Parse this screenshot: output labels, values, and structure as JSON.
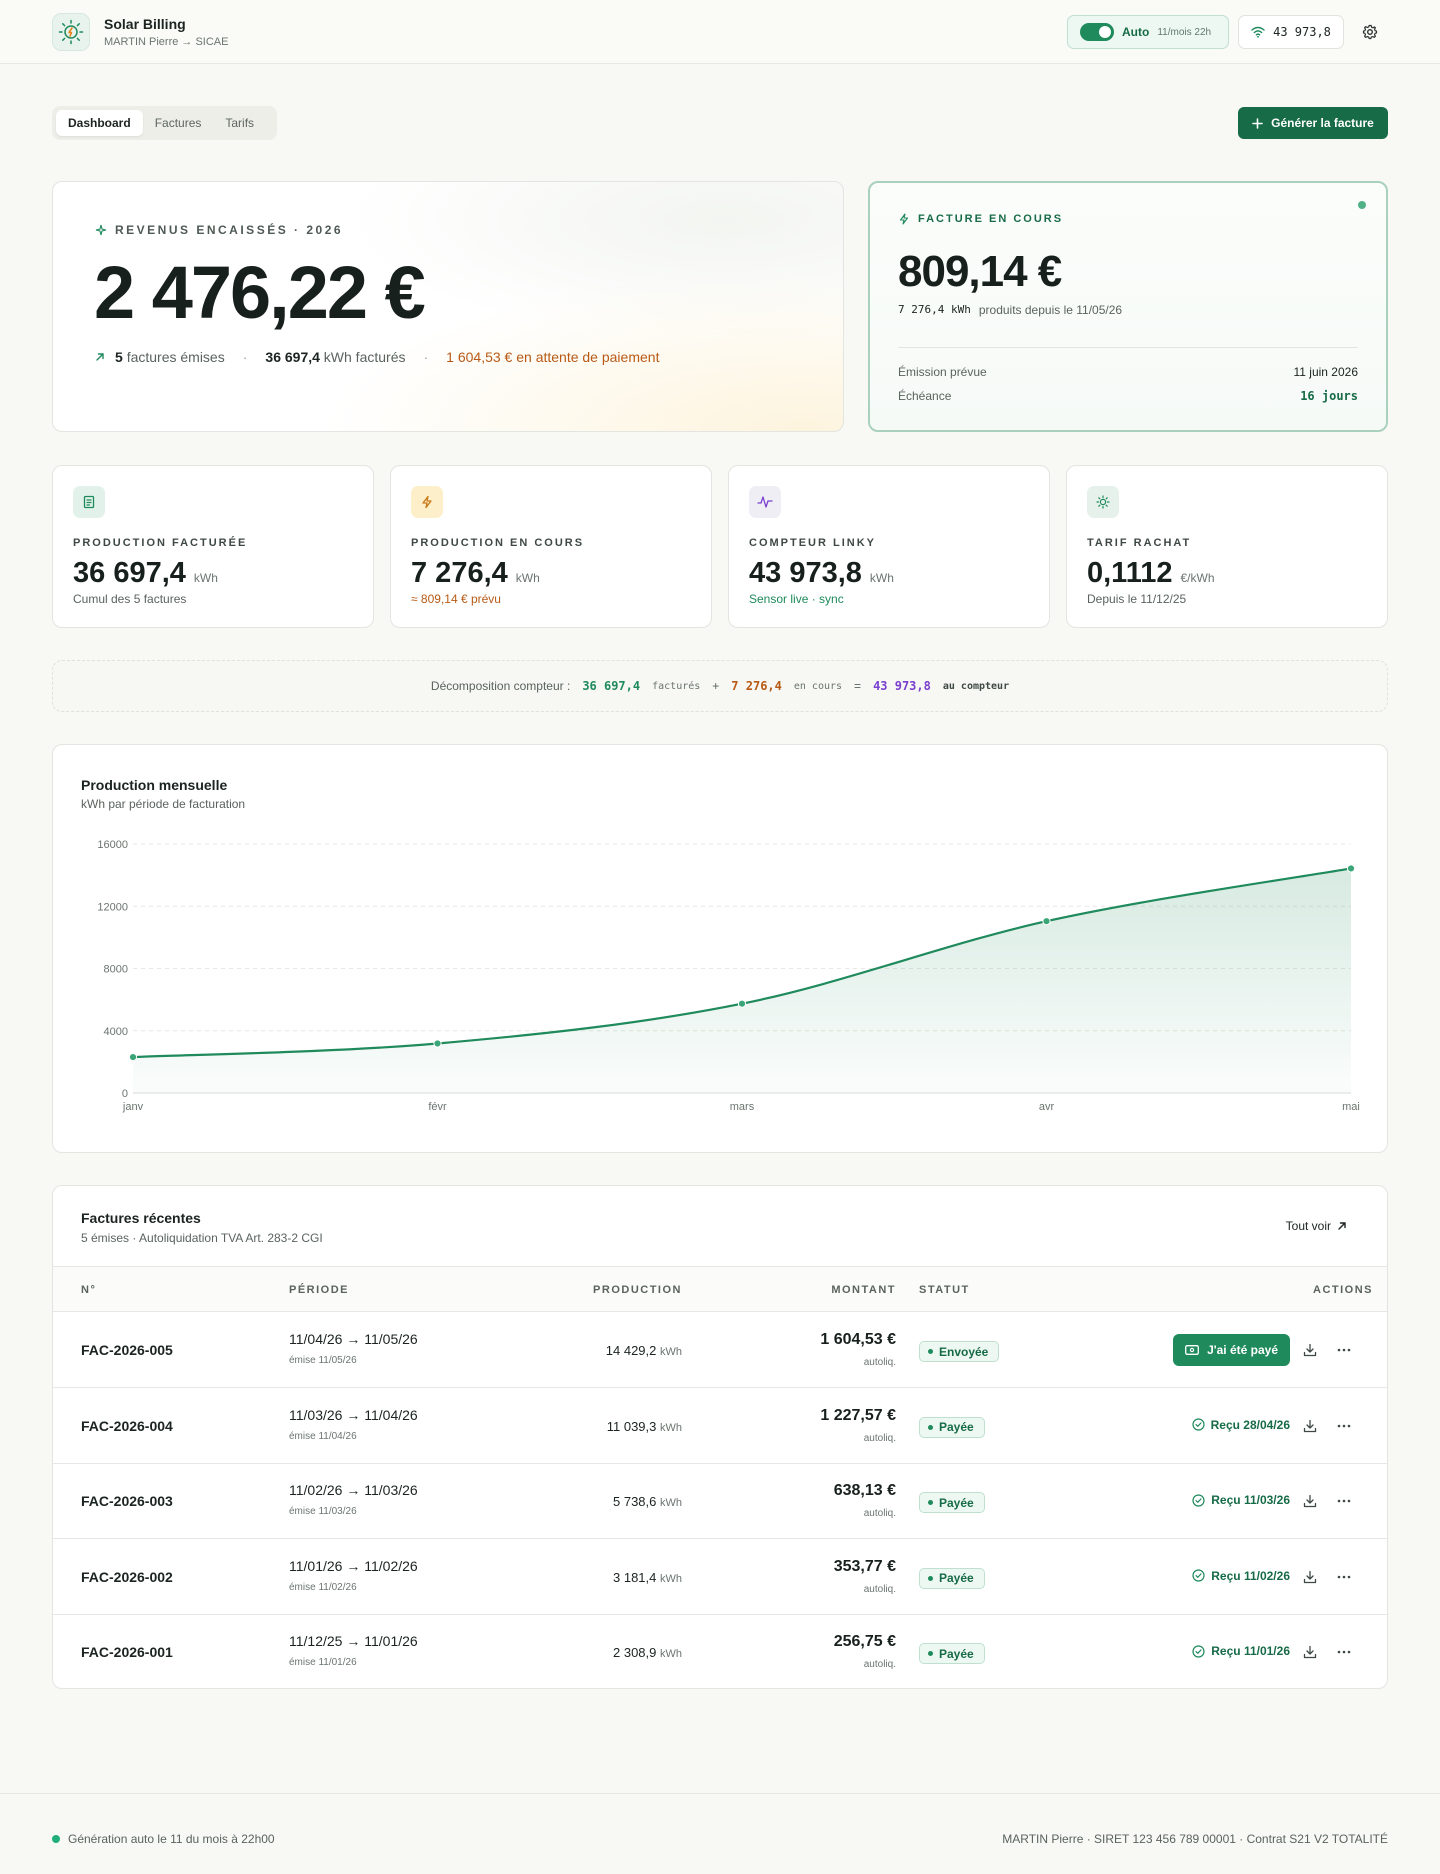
{
  "header": {
    "title": "Solar Billing",
    "subtitle": "MARTIN Pierre → SICAE",
    "auto_label": "Auto",
    "auto_schedule": "11/mois 22h",
    "meter_reading": "43 973,8"
  },
  "tabs": [
    {
      "label": "Dashboard",
      "active": true
    },
    {
      "label": "Factures",
      "active": false
    },
    {
      "label": "Tarifs",
      "active": false
    }
  ],
  "generate_button": "Générer la facture",
  "revenue": {
    "label": "REVENUS ENCAISSÉS · 2026",
    "amount": "2 476,22 €",
    "invoices_count": "5",
    "invoices_text": "factures émises",
    "kwh_value": "36 697,4",
    "kwh_text": "kWh facturés",
    "pending": "1 604,53 € en attente de paiement"
  },
  "current_invoice": {
    "label": "FACTURE EN COURS",
    "amount": "809,14 €",
    "kwh": "7 276,4 kWh",
    "since": "produits depuis le 11/05/26",
    "emission_label": "Émission prévue",
    "emission_value": "11 juin 2026",
    "due_label": "Échéance",
    "due_value": "16 jours"
  },
  "metrics": [
    {
      "label": "PRODUCTION FACTURÉE",
      "value": "36 697,4",
      "unit": "kWh",
      "sub": "Cumul des 5 factures",
      "icon": "invoice-icon"
    },
    {
      "label": "PRODUCTION EN COURS",
      "value": "7 276,4",
      "unit": "kWh",
      "sub": "≈ 809,14 € prévu",
      "icon": "bolt-icon"
    },
    {
      "label": "COMPTEUR LINKY",
      "value": "43 973,8",
      "unit": "kWh",
      "sub": "Sensor live · sync",
      "icon": "pulse-icon"
    },
    {
      "label": "TARIF RACHAT",
      "value": "0,1112",
      "unit": "€/kWh",
      "sub": "Depuis le 11/12/25",
      "icon": "sun-icon"
    }
  ],
  "decomposition": {
    "label": "Décomposition compteur :",
    "billed": "36 697,4",
    "billed_text": "facturés",
    "plus": "+",
    "current": "7 276,4",
    "current_text": "en cours",
    "equals": "=",
    "total": "43 973,8",
    "total_text": "au compteur"
  },
  "chart": {
    "title": "Production mensuelle",
    "subtitle": "kWh par période de facturation"
  },
  "chart_data": {
    "type": "area",
    "categories": [
      "janv",
      "févr",
      "mars",
      "avr",
      "mai"
    ],
    "values": [
      2308.9,
      3181.4,
      5738.6,
      11039.3,
      14429.2
    ],
    "ylim": [
      0,
      16000
    ],
    "yticks": [
      "0",
      "4000",
      "8000",
      "12000",
      "16000"
    ],
    "ytick_values": [
      0,
      4000,
      8000,
      12000,
      16000
    ],
    "grid": true,
    "color": "#1f8a5c"
  },
  "invoices": {
    "title": "Factures récentes",
    "subtitle": "5 émises · Autoliquidation TVA Art. 283-2 CGI",
    "see_all": "Tout voir",
    "columns": [
      "N°",
      "PÉRIODE",
      "PRODUCTION",
      "MONTANT",
      "STATUT",
      "ACTIONS"
    ],
    "rows": [
      {
        "id": "FAC-2026-005",
        "period": "11/04/26 → 11/05/26",
        "issued": "émise 11/05/26",
        "prod": "14 429,2",
        "unit": "kWh",
        "amount": "1 604,53 €",
        "note": "autoliq.",
        "status": "Envoyée",
        "action": "J'ai été payé"
      },
      {
        "id": "FAC-2026-004",
        "period": "11/03/26 → 11/04/26",
        "issued": "émise 11/04/26",
        "prod": "11 039,3",
        "unit": "kWh",
        "amount": "1 227,57 €",
        "note": "autoliq.",
        "status": "Payée",
        "action": "Reçu 28/04/26"
      },
      {
        "id": "FAC-2026-003",
        "period": "11/02/26 → 11/03/26",
        "issued": "émise 11/03/26",
        "prod": "5 738,6",
        "unit": "kWh",
        "amount": "638,13 €",
        "note": "autoliq.",
        "status": "Payée",
        "action": "Reçu 11/03/26"
      },
      {
        "id": "FAC-2026-002",
        "period": "11/01/26 → 11/02/26",
        "issued": "émise 11/02/26",
        "prod": "3 181,4",
        "unit": "kWh",
        "amount": "353,77 €",
        "note": "autoliq.",
        "status": "Payée",
        "action": "Reçu 11/02/26"
      },
      {
        "id": "FAC-2026-001",
        "period": "11/12/25 → 11/01/26",
        "issued": "émise 11/01/26",
        "prod": "2 308,9",
        "unit": "kWh",
        "amount": "256,75 €",
        "note": "autoliq.",
        "status": "Payée",
        "action": "Reçu 11/01/26"
      }
    ]
  },
  "footer": {
    "left": "Génération auto le 11 du mois à 22h00",
    "right": "MARTIN Pierre · SIRET 123 456 789 00001 · Contrat S21 V2 TOTALITÉ"
  }
}
